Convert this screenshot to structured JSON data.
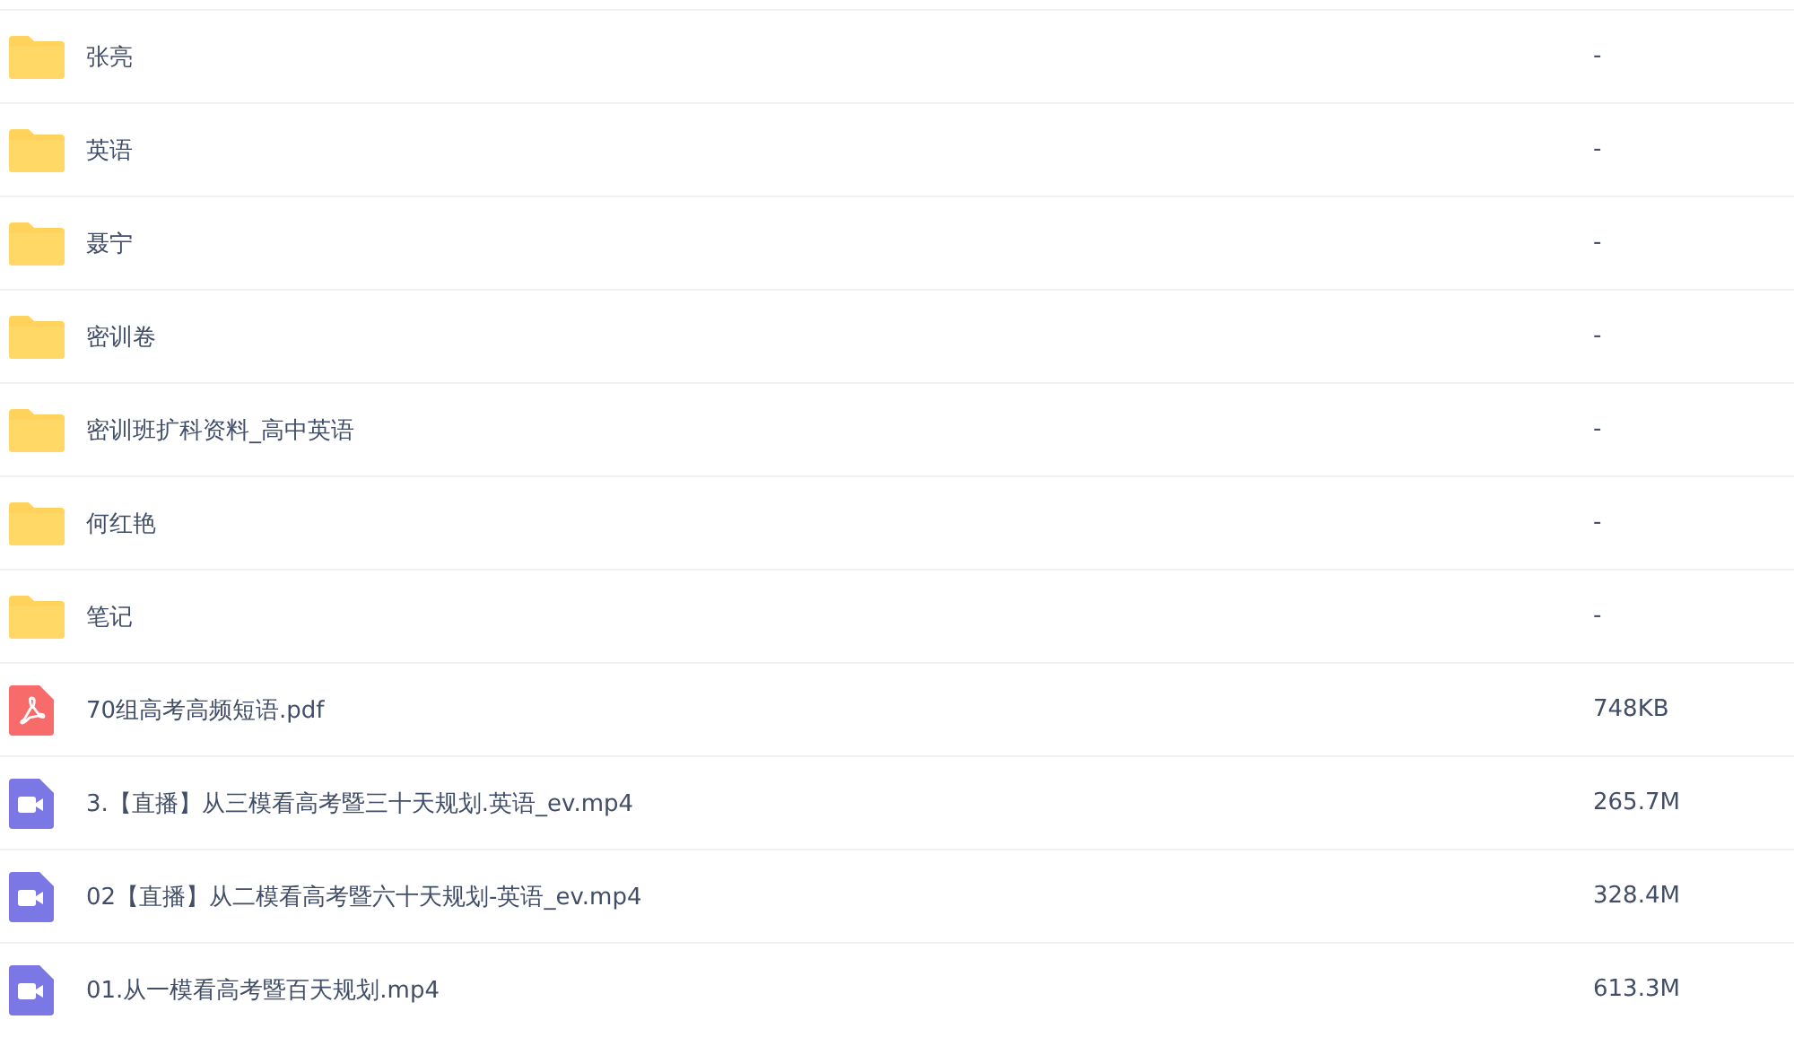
{
  "files": [
    {
      "kind": "folder",
      "name": "张亮",
      "size": "-"
    },
    {
      "kind": "folder",
      "name": "英语",
      "size": "-"
    },
    {
      "kind": "folder",
      "name": "聂宁",
      "size": "-"
    },
    {
      "kind": "folder",
      "name": "密训卷",
      "size": "-"
    },
    {
      "kind": "folder",
      "name": "密训班扩科资料_高中英语",
      "size": "-"
    },
    {
      "kind": "folder",
      "name": "何红艳",
      "size": "-"
    },
    {
      "kind": "folder",
      "name": "笔记",
      "size": "-"
    },
    {
      "kind": "pdf",
      "name": "70组高考高频短语.pdf",
      "size": "748KB"
    },
    {
      "kind": "video",
      "name": "3.【直播】从三模看高考暨三十天规划.英语_ev.mp4",
      "size": "265.7M"
    },
    {
      "kind": "video",
      "name": "02【直播】从二模看高考暨六十天规划-英语_ev.mp4",
      "size": "328.4M"
    },
    {
      "kind": "video",
      "name": "01.从一模看高考暨百天规划.mp4",
      "size": "613.3M"
    }
  ]
}
